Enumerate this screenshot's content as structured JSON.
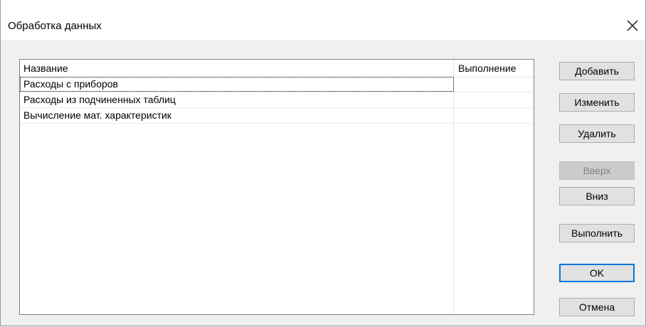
{
  "window": {
    "title": "Обработка данных"
  },
  "list": {
    "columns": [
      "Название",
      "Выполнение"
    ],
    "rows": [
      {
        "name": "Расходы с приборов",
        "exec": ""
      },
      {
        "name": "Расходы из подчиненных таблиц",
        "exec": ""
      },
      {
        "name": "Вычисление мат. характеристик",
        "exec": ""
      }
    ]
  },
  "buttons": {
    "add": "Добавить",
    "edit": "Изменить",
    "delete": "Удалить",
    "up": "Вверх",
    "down": "Вниз",
    "run": "Выполнить",
    "ok": "OK",
    "cancel": "Отмена"
  },
  "icons": {
    "close": "close-icon"
  },
  "colors": {
    "default_button_border": "#0078d7",
    "disabled_button_text": "#838383"
  }
}
